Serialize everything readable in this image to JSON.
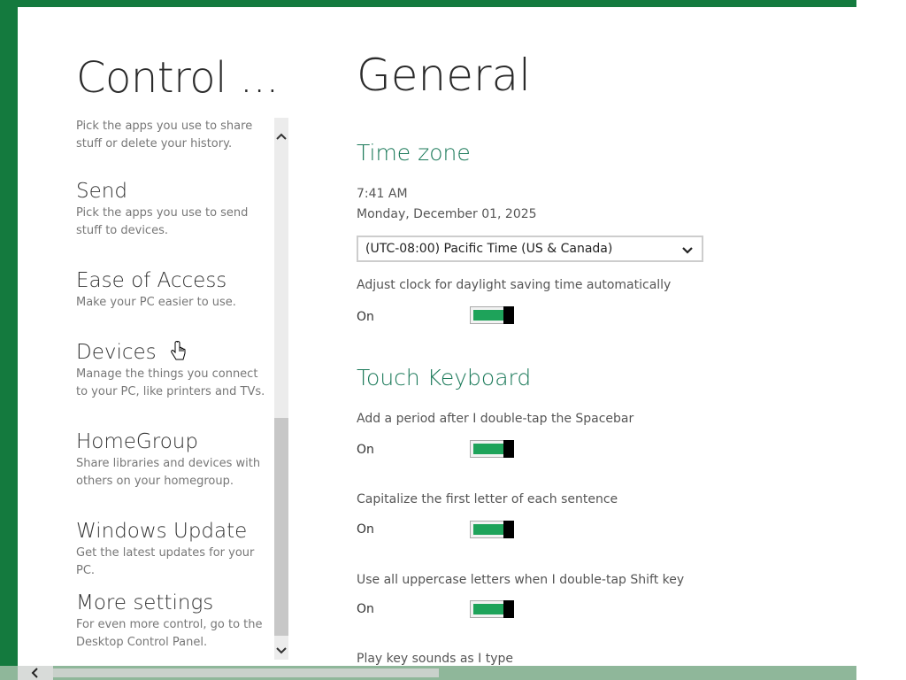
{
  "left_panel": {
    "title": "Control ...",
    "intro_desc": "Pick the apps you use to share stuff or delete your history.",
    "items": [
      {
        "title": "Send",
        "desc": "Pick the apps you use to send stuff to devices."
      },
      {
        "title": "Ease of Access",
        "desc": "Make your PC easier to use."
      },
      {
        "title": "Devices",
        "desc": "Manage the things you connect to your PC, like printers and TVs."
      },
      {
        "title": "HomeGroup",
        "desc": "Share libraries and devices with others on your homegroup."
      },
      {
        "title": "Windows Update",
        "desc": "Get the latest updates for your PC."
      },
      {
        "title": "More settings",
        "desc": "For even more control, go to the Desktop Control Panel."
      }
    ]
  },
  "main": {
    "title": "General",
    "time_zone": {
      "heading": "Time zone",
      "time": "7:41 AM",
      "date": "Monday, December 01, 2025",
      "selected_zone": "(UTC-08:00) Pacific Time (US & Canada)",
      "dst_label": "Adjust clock for daylight saving time automatically",
      "dst_state": "On"
    },
    "touch_keyboard": {
      "heading": "Touch Keyboard",
      "period_label": "Add a period after I double-tap the Spacebar",
      "period_state": "On",
      "capitalize_label": "Capitalize the first letter of each sentence",
      "capitalize_state": "On",
      "uppercase_label": "Use all uppercase letters when I double-tap Shift key",
      "uppercase_state": "On",
      "key_sounds_label": "Play key sounds as I type"
    }
  },
  "colors": {
    "accent_green": "#1ea35a",
    "section_heading": "#1c7a5a",
    "frame_green": "#147a3e"
  },
  "icons": {
    "scroll_up": "chevron-up-icon",
    "scroll_down": "chevron-down-icon",
    "dropdown": "chevron-down-icon",
    "bottom_left": "chevron-left-icon",
    "cursor": "hand-cursor-icon"
  }
}
